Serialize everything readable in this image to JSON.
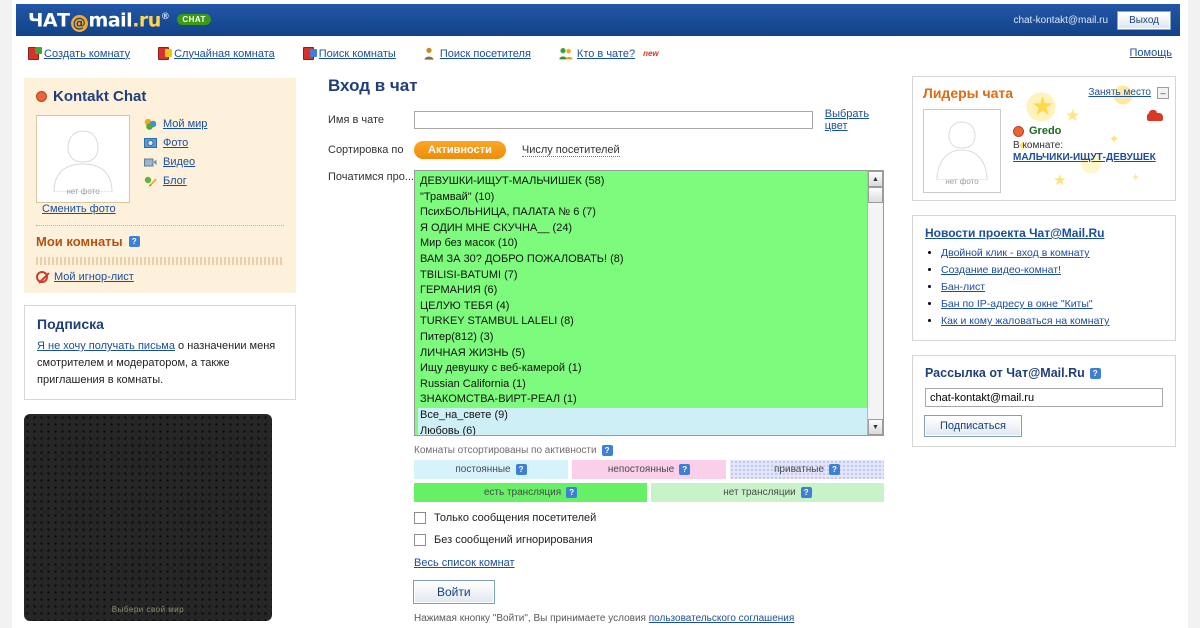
{
  "header": {
    "logo_text_1": "ЧАТ",
    "logo_at": "@",
    "logo_text_2": "mail",
    "logo_ru": ".ru",
    "logo_sup": "®",
    "logo_badge": "CHAT",
    "user_email": "chat-kontakt@mail.ru",
    "exit_label": "Выход",
    "help_label": "Помощь",
    "bg_color": "#1a4d9c"
  },
  "nav": {
    "items": [
      {
        "label": "Создать комнату",
        "icon": "door-plus-icon"
      },
      {
        "label": "Случайная комната",
        "icon": "door-random-icon"
      },
      {
        "label": "Поиск комнаты",
        "icon": "door-search-icon"
      },
      {
        "label": "Поиск посетителя",
        "icon": "person-search-icon"
      },
      {
        "label": "Кто в чате?",
        "icon": "people-icon",
        "badge": "new"
      }
    ]
  },
  "sidebar": {
    "profile_title": "Kontakt Chat",
    "no_photo_caption": "нет фото",
    "links": [
      {
        "label": "Мой мир",
        "icon": "my-world-icon"
      },
      {
        "label": "Фото",
        "icon": "photo-icon"
      },
      {
        "label": "Видео",
        "icon": "video-icon"
      },
      {
        "label": "Блог",
        "icon": "blog-icon"
      }
    ],
    "change_photo": "Сменить фото",
    "my_rooms": "Мои комнаты",
    "ignore_list": "Мой игнор-лист",
    "subscription": {
      "title": "Подписка",
      "link": "Я не хочу получать письма",
      "text": " о назначении меня смотрителем и модератором, а также приглашения в комнаты."
    },
    "ad_caption": "Выбери свой мир"
  },
  "main": {
    "title": "Вход в чат",
    "name_label": "Имя в чате",
    "name_value": "",
    "name_placeholder": "",
    "pick_color": "Выбрать цвет",
    "sort_label": "Сортировка по",
    "sort_active": "Активности",
    "sort_alt": "Числу посетителей",
    "topic_label": "Початимся про...",
    "rooms": [
      {
        "name": "ДЕВУШКИ-ИЩУТ-МАЛЬЧИШЕК (58)",
        "type": "permanent"
      },
      {
        "name": "\"Трамвай\" (10)",
        "type": "permanent"
      },
      {
        "name": "ПсихБОЛЬНИЦА, ПАЛАТА № 6 (7)",
        "type": "permanent"
      },
      {
        "name": "Я ОДИН МНЕ СКУЧНА__ (24)",
        "type": "permanent"
      },
      {
        "name": "Мир без масок (10)",
        "type": "permanent"
      },
      {
        "name": "ВАМ ЗА 30? ДОБРО ПОЖАЛОВАТЬ! (8)",
        "type": "permanent"
      },
      {
        "name": "TBILISI-BATUMI (7)",
        "type": "permanent"
      },
      {
        "name": "ГЕРМАНИЯ (6)",
        "type": "permanent"
      },
      {
        "name": "ЦЕЛУЮ ТЕБЯ (4)",
        "type": "permanent"
      },
      {
        "name": "TURKEY STAMBUL LALELI (8)",
        "type": "permanent"
      },
      {
        "name": "Питер(812) (3)",
        "type": "permanent"
      },
      {
        "name": "ЛИЧНАЯ ЖИЗНЬ  (5)",
        "type": "permanent"
      },
      {
        "name": "Ищу девушку с веб-камерой (1)",
        "type": "permanent"
      },
      {
        "name": "Russian California (1)",
        "type": "permanent"
      },
      {
        "name": "ЗНАКОМСТВА-ВИРТ-РЕАЛ (1)",
        "type": "permanent"
      },
      {
        "name": "Все_на_свете (9)",
        "type": "alt"
      },
      {
        "name": "Любовь (6)",
        "type": "alt"
      }
    ],
    "sorted_note": "Комнаты отсортированы по активности",
    "legend_top": [
      {
        "label": "постоянные",
        "color": "#d6f2fa"
      },
      {
        "label": "непостоянные",
        "color": "#f9cfe9"
      },
      {
        "label": "приватные",
        "color": "#e3e6fa"
      }
    ],
    "legend_bottom": [
      {
        "label": "есть трансляция",
        "color": "#66f066"
      },
      {
        "label": "нет трансляции",
        "color": "#c8f3c8"
      }
    ],
    "checkboxes": [
      {
        "label": "Только сообщения посетителей",
        "checked": false
      },
      {
        "label": "Без сообщений игнорирования",
        "checked": false
      }
    ],
    "all_rooms_link": "Весь список комнат",
    "enter_button": "Войти",
    "legal_prefix": "Нажимая кнопку \"Войти\", Вы принимаете условия ",
    "legal_link": "пользовательского соглашения"
  },
  "right": {
    "leaders": {
      "title": "Лидеры чата",
      "take_seat": "Занять место",
      "collapse": "–",
      "no_photo_caption": "нет фото",
      "user_name": "Gredo",
      "in_room_label": "В комнате:",
      "room_name": "МАЛЬЧИКИ-ИЩУТ-ДЕВУШЕК"
    },
    "news": {
      "title": "Новости проекта Чат@Mail.Ru",
      "items": [
        "Двойной клик - вход в комнату",
        "Создание видео-комнат!",
        "Бан-лист",
        "Бан по IP-адресу в окне \"Киты\"",
        "Как и кому жаловаться на комнату"
      ]
    },
    "mailing": {
      "title": "Рассылка от Чат@Mail.Ru",
      "email_value": "chat-kontakt@mail.ru",
      "email_placeholder": "",
      "button": "Подписаться"
    }
  }
}
